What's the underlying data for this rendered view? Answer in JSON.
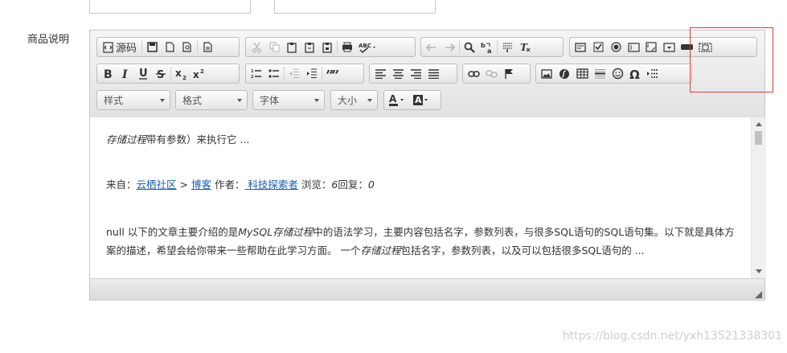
{
  "form": {
    "label": "商品说明"
  },
  "toolbar": {
    "source_label": "源码",
    "font_placeholders": {
      "style": "样式",
      "format": "格式",
      "font": "字体",
      "size": "大小"
    },
    "icons": {
      "source": "source-icon",
      "save": "save-icon",
      "new_page": "new-page-icon",
      "preview": "preview-icon",
      "templates": "templates-icon",
      "cut": "cut-icon",
      "copy": "copy-icon",
      "paste": "paste-icon",
      "paste_text": "paste-text-icon",
      "paste_word": "paste-word-icon",
      "print": "print-icon",
      "spellcheck": "spellcheck-icon",
      "undo": "undo-icon",
      "redo": "redo-icon",
      "find": "find-icon",
      "replace": "replace-icon",
      "select_all": "select-all-icon",
      "remove_format": "remove-format-icon",
      "form": "form-icon",
      "checkbox": "checkbox-icon",
      "radio": "radio-icon",
      "textfield": "textfield-icon",
      "textarea": "textarea-icon",
      "select": "select-icon",
      "button": "button-icon",
      "image_button": "image-button-icon",
      "bold": "bold-icon",
      "italic": "italic-icon",
      "underline": "underline-icon",
      "strike": "strikethrough-icon",
      "subscript": "subscript-icon",
      "superscript": "superscript-icon",
      "numbered_list": "numbered-list-icon",
      "bulleted_list": "bulleted-list-icon",
      "outdent": "outdent-icon",
      "indent": "indent-icon",
      "blockquote": "blockquote-icon",
      "align_left": "align-left-icon",
      "align_center": "align-center-icon",
      "align_right": "align-right-icon",
      "justify": "justify-icon",
      "link": "link-icon",
      "unlink": "unlink-icon",
      "anchor": "anchor-icon",
      "image": "image-icon",
      "flash": "flash-icon",
      "table": "table-icon",
      "horizontal_rule": "horizontal-rule-icon",
      "smiley": "smiley-icon",
      "special_char": "omega-icon",
      "page_break": "page-break-icon",
      "text_color": "text-color-icon",
      "bg_color": "background-color-icon"
    }
  },
  "content": {
    "line1_italic": "存储过程",
    "line1_rest": "带有参数）来执行它 ...",
    "source_prefix": "来自：",
    "source_link": "云栖社区",
    "source_sep": " > ",
    "category_link": "博客",
    "author_prefix": " 作者：",
    "author_link": " 科技探索者",
    "views_prefix": " 浏览：",
    "views": "6",
    "replies_prefix": "回复：",
    "replies": "0",
    "para_a": "null 以下的文章主要介绍的是",
    "para_b_italic": "MySQL存储过程",
    "para_c": "中的语法学习，主要内容包括名字，参数列表，与很多SQL语句的SQL语句集。以下就是具体方案的描述，希望会给你带来一些帮助在此学习方面。 一个",
    "para_d_italic": "存储过程",
    "para_e": "包括名字，参数列表，以及可以包括很多SQL语句的 ..."
  },
  "watermark": "https://blog.csdn.net/yxh13521338301",
  "colors": {
    "link": "#1a5fb4",
    "highlight_border": "#e23a3a"
  }
}
